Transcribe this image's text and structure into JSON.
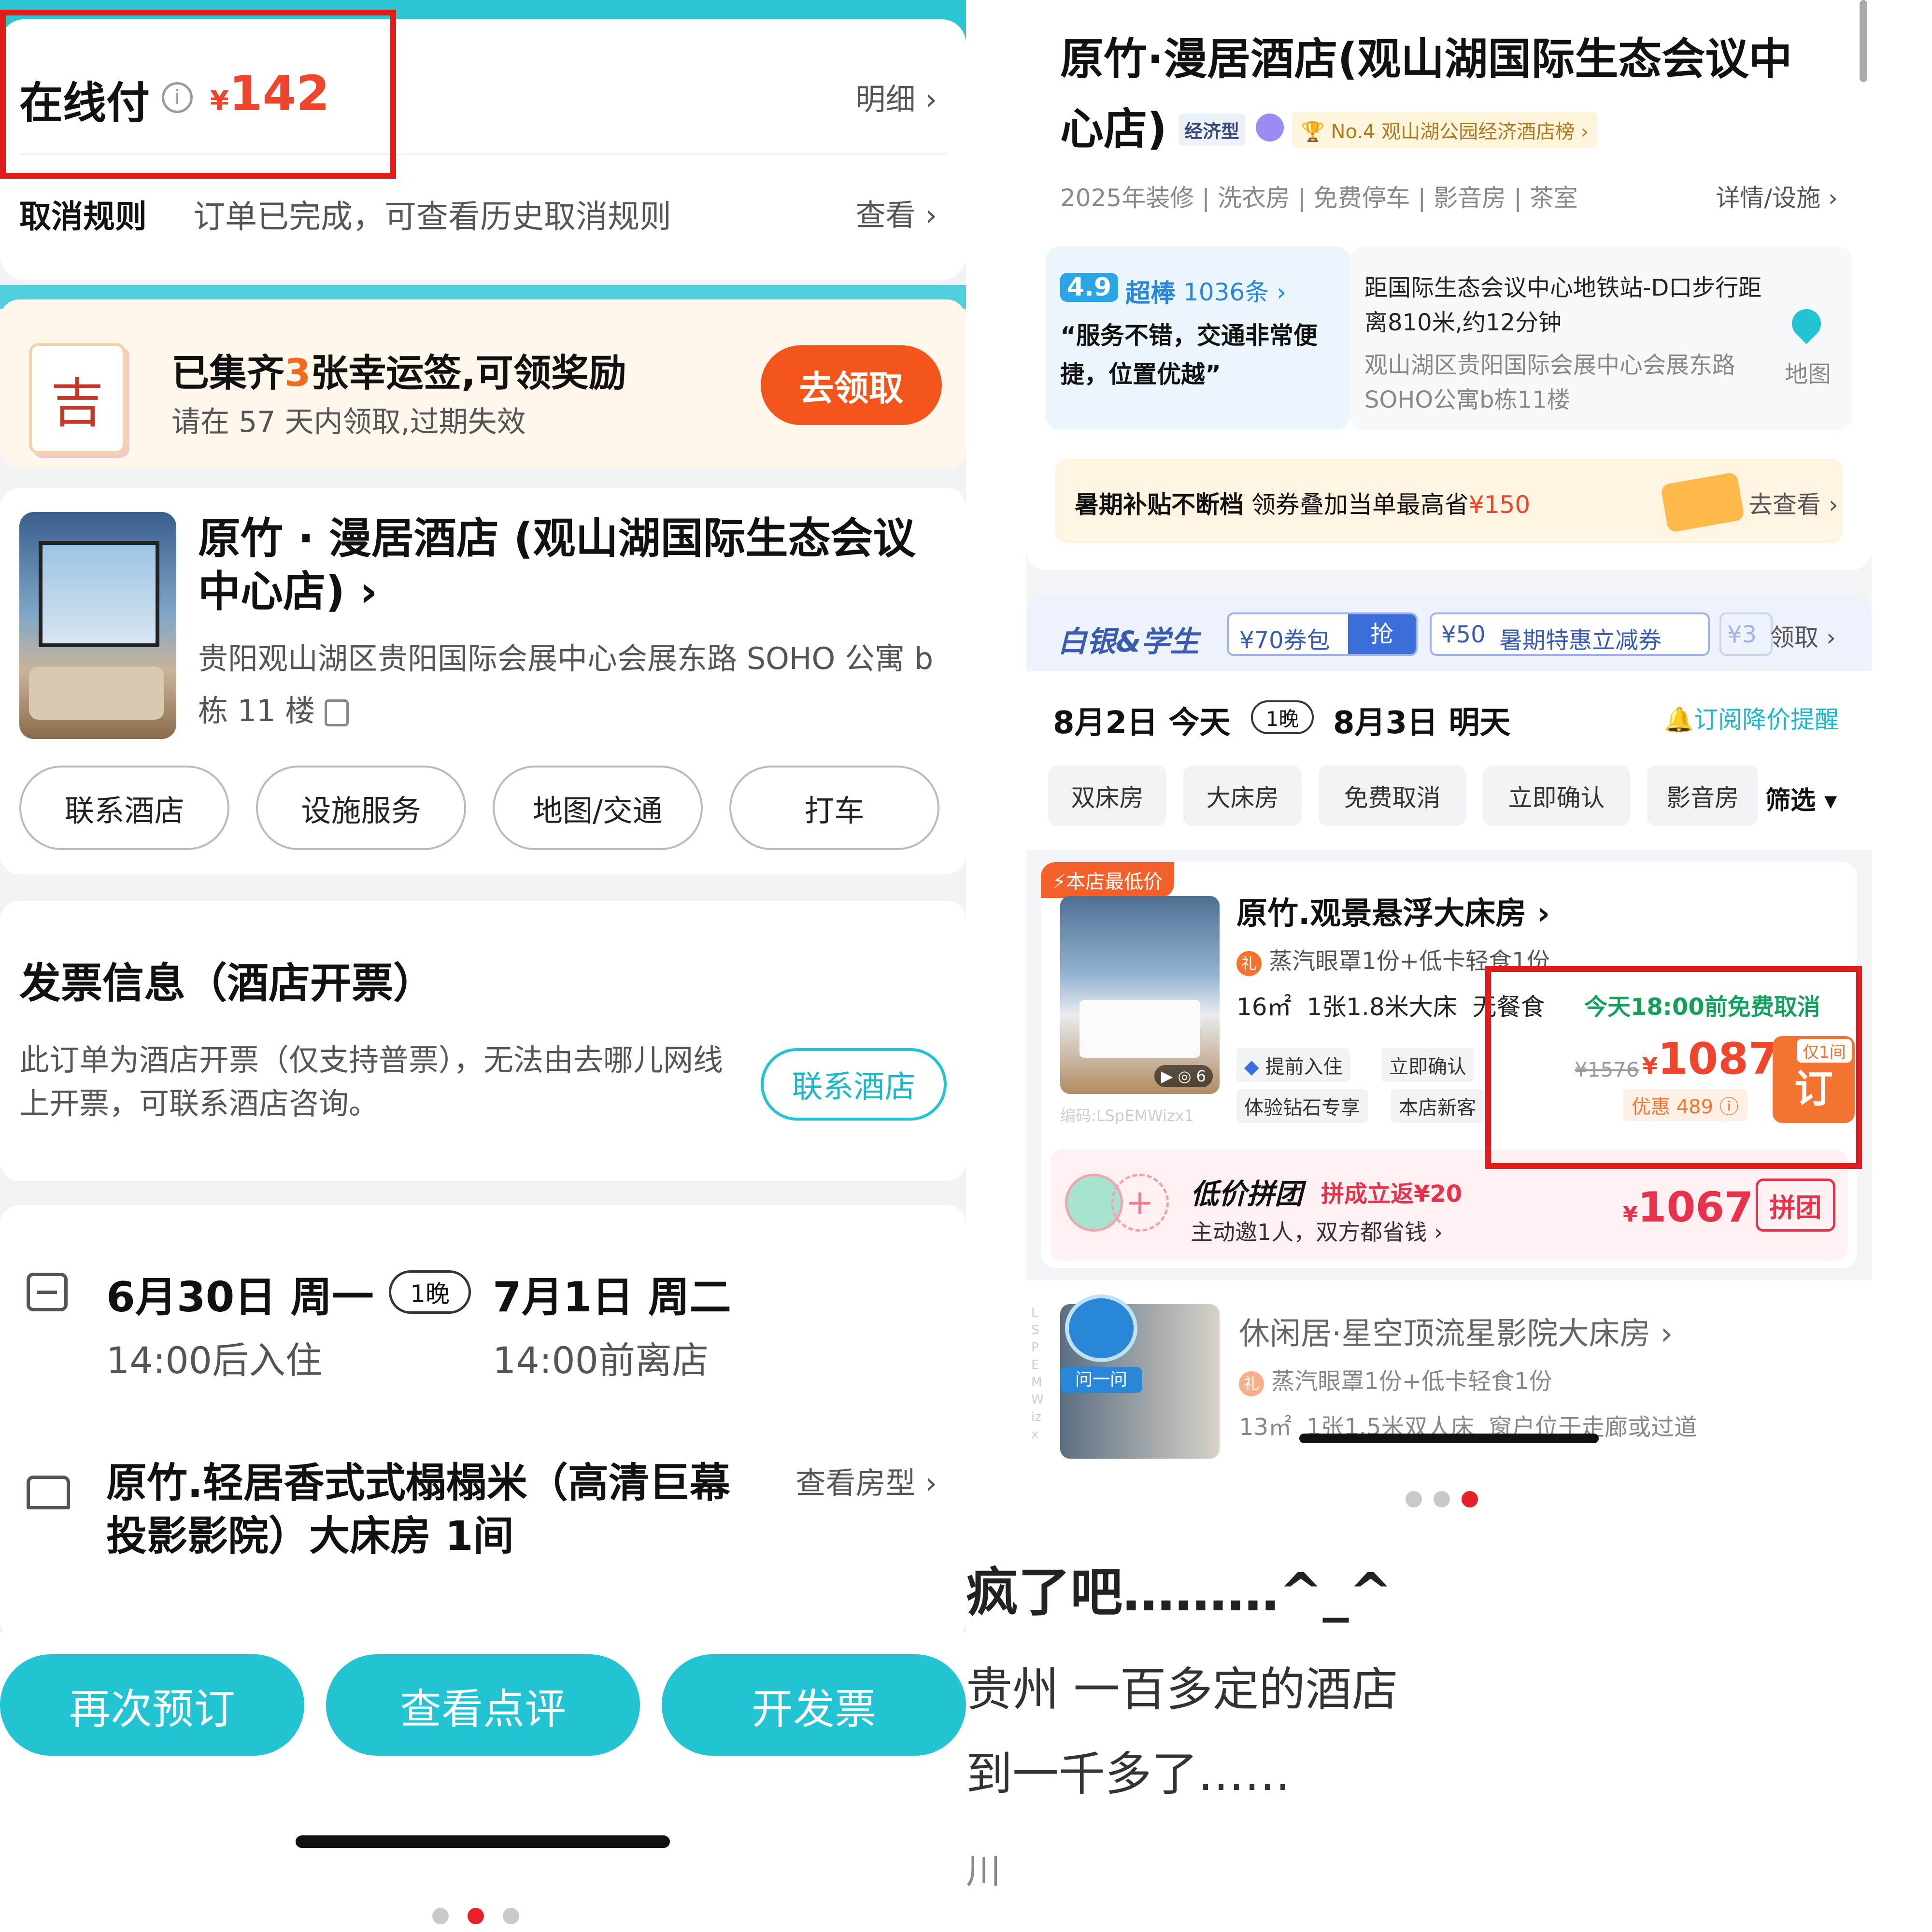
{
  "left": {
    "pay": {
      "label": "在线付",
      "currency": "¥",
      "amount": "142",
      "detail": "明细",
      "info_icon": "info-icon"
    },
    "cancel": {
      "label": "取消规则",
      "text": "订单已完成，可查看历史取消规则",
      "link": "查看"
    },
    "lucky": {
      "title_pre": "已集齐",
      "count": "3",
      "title_post": "张幸运签,可领奖励",
      "sub": "请在 57 天内领取,过期失效",
      "button": "去领取",
      "sign_char": "吉"
    },
    "hotel": {
      "name": "原竹 · 漫居酒店 (观山湖国际生态会议中心店)",
      "address": "贵阳观山湖区贵阳国际会展中心会展东路 SOHO 公寓 b 栋 11 楼"
    },
    "actions": [
      "联系酒店",
      "设施服务",
      "地图/交通",
      "打车"
    ],
    "invoice": {
      "title": "发票信息（酒店开票）",
      "text": "此订单为酒店开票（仅支持普票），无法由去哪儿网线上开票，可联系酒店咨询。",
      "button": "联系酒店"
    },
    "stay": {
      "checkin_date": "6月30日 周一",
      "nights": "1晚",
      "checkout_date": "7月1日 周二",
      "checkin_time": "14:00后入住",
      "checkout_time": "14:00前离店"
    },
    "room": {
      "name": "原竹.轻居香式式榻榻米（高清巨幕投影影院）大床房 1间",
      "link": "查看房型"
    },
    "bottom": [
      "再次预订",
      "查看点评",
      "开发票"
    ]
  },
  "right": {
    "hotel": {
      "name": "原竹·漫居酒店(观山湖国际生态会议中心店)",
      "type": "经济型",
      "rank": "No.4 观山湖公园经济酒店榜"
    },
    "tags": [
      "2025年装修",
      "洗衣房",
      "免费停车",
      "影音房",
      "茶室"
    ],
    "details_link": "详情/设施",
    "rating": {
      "score": "4.9",
      "label": "超棒",
      "count": "1036条",
      "quote": "“服务不错，交通非常便捷，位置优越”"
    },
    "location": {
      "line1": "距国际生态会议中心地铁站-D口步行距离810米,约12分钟",
      "line2": "观山湖区贵阳国际会展中心会展东路SOHO公寓b栋11楼",
      "map": "地图"
    },
    "promo": {
      "title": "暑期补贴不断档",
      "text_pre": "领券叠加当单最高省",
      "amount": "¥150",
      "link": "去查看"
    },
    "coupons": {
      "brand": "白银&学生",
      "c1": "¥70券包",
      "c1_btn": "抢",
      "c2": "¥50",
      "c2_label": "暑期特惠立减券",
      "c3": "¥3",
      "claim": "领取"
    },
    "dates": {
      "checkin": "8月2日 今天",
      "nights": "1晚",
      "checkout": "8月3日 明天",
      "subscribe": "订阅降价提醒"
    },
    "filters": [
      "双床房",
      "大床房",
      "免费取消",
      "立即确认",
      "影音房"
    ],
    "filter_btn": "筛选",
    "room1": {
      "badge": "本店最低价",
      "name": "原竹.观景悬浮大床房",
      "gift": "蒸汽眼罩1份+低卡轻食1份",
      "area": "16㎡",
      "bed": "1张1.8米大床",
      "meal": "无餐食",
      "cancel": "今天18:00前免费取消",
      "tags1": [
        "提前入住",
        "立即确认"
      ],
      "tags2": [
        "体验钻石专享",
        "本店新客"
      ],
      "orig_price": "¥1576",
      "price": "1087",
      "discount": "优惠 489",
      "book": "订",
      "only": "仅1间",
      "code": "编码:LSpEMWizx1",
      "media": "6"
    },
    "group": {
      "title": "低价拼团",
      "back": "拼成立返¥20",
      "sub": "主动邀1人，双方都省钱",
      "price": "1067",
      "btn": "拼团"
    },
    "room2": {
      "name": "休闲居·星空顶流星影院大床房",
      "gift": "蒸汽眼罩1份+低卡轻食1份",
      "info": "13㎡  1张1.5米双人床  窗户位于走廊或过道",
      "ask": "问一问",
      "side_code": "LSPEMWizx"
    },
    "caption": {
      "line1": "疯了吧………^_^",
      "line2": "贵州 一百多定的酒店",
      "line3": "到一千多了……",
      "line4": "川"
    }
  }
}
